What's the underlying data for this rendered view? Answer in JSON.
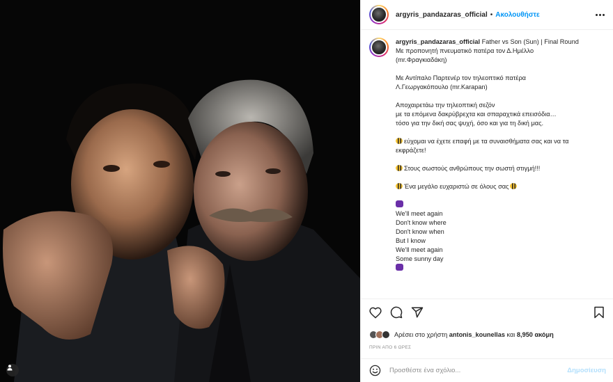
{
  "post": {
    "username": "argyris_pandazaras_official",
    "follow_label": "Ακολουθήστε",
    "separator": "•"
  },
  "caption": {
    "title": "Father vs Son (Sun) | Final Round",
    "lines": [
      "Με προπονητή πνευματικό πατέρα τον Δ.Ημέλλο",
      "(mr.Φραγκιαδάκη)",
      "",
      "Με Αντίπαλο Παρτενέρ τον τηλεοπτικό πατέρα",
      "Λ.Γεωργακόπουλο (mr.Karapan)",
      "",
      "Αποχαιρετάω την τηλεοπτική σεζόν",
      "με τα επόμενα δακρύβρεχτα και σπαραχτικά επεισόδια…",
      "τόσο για την δική σας ψυχή, όσο και για τη δική μας.",
      "",
      "εύχομαι να έχετε επαφή με τα συναισθήματα σας και να τα",
      "εκφράζετε!",
      "",
      "Στους σωστούς ανθρώπους την σωστή στιγμή!!!",
      "",
      "Ένα μεγάλο ευχαριστώ σε όλους σας",
      "",
      "",
      "We'll meet again",
      "Don't know where",
      "Don't know when",
      "But I know",
      "We'll meet again",
      "Some sunny day",
      ""
    ]
  },
  "likes": {
    "prefix": "Αρέσει στο χρήστη",
    "user": "antonis_kounellas",
    "conj": "και",
    "count": "8,950 ακόμη"
  },
  "time_label": "ΠΡΙΝ ΑΠΟ 6 ΩΡΕΣ",
  "comment": {
    "placeholder": "Προσθέστε ένα σχόλιο...",
    "post_label": "Δημοσίευση"
  },
  "colors": {
    "accent": "#0095f6",
    "post_disabled": "#b2dffc",
    "text": "#262626",
    "muted": "#8e8e8e"
  },
  "icons": [
    "heart-icon",
    "comment-icon",
    "share-icon",
    "bookmark-icon",
    "emoji-icon",
    "more-icon",
    "user-tag-icon"
  ]
}
